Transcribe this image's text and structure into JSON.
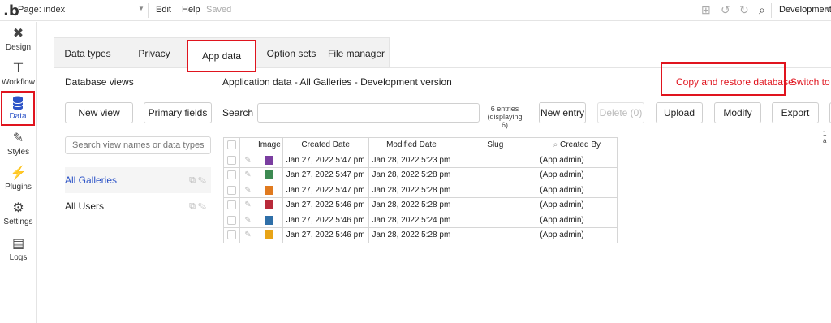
{
  "topbar": {
    "logo": ".b",
    "page_label": "Page: index",
    "menu_edit": "Edit",
    "menu_help": "Help",
    "saved": "Saved",
    "environment": "Development"
  },
  "rail": {
    "items": [
      {
        "label": "Design",
        "icon": "design-icon"
      },
      {
        "label": "Workflow",
        "icon": "workflow-icon"
      },
      {
        "label": "Data",
        "icon": "database-icon"
      },
      {
        "label": "Styles",
        "icon": "brush-icon"
      },
      {
        "label": "Plugins",
        "icon": "plug-icon"
      },
      {
        "label": "Settings",
        "icon": "gear-icon"
      },
      {
        "label": "Logs",
        "icon": "document-icon"
      }
    ],
    "active": "Data"
  },
  "tabs": [
    {
      "label": "Data types"
    },
    {
      "label": "Privacy"
    },
    {
      "label": "App data"
    },
    {
      "label": "Option sets"
    },
    {
      "label": "File manager"
    }
  ],
  "active_tab": "App data",
  "left": {
    "title": "Database views",
    "new_view": "New view",
    "primary_fields": "Primary fields",
    "search_placeholder": "Search view names or data types...",
    "views": [
      {
        "label": "All Galleries"
      },
      {
        "label": "All Users"
      }
    ]
  },
  "main": {
    "title": "Application data - All Galleries - Development version",
    "copy_restore": "Copy and restore database",
    "switch_live": "Switch to li",
    "search_label": "Search",
    "entries_line1": "6 entries",
    "entries_line2": "(displaying 6)",
    "new_entry": "New entry",
    "delete": "Delete (0)",
    "upload": "Upload",
    "modify": "Modify",
    "export": "Export",
    "tiny": "1 a"
  },
  "table": {
    "columns": [
      "Image",
      "Created Date",
      "Modified Date",
      "Slug",
      "Created By"
    ],
    "rows": [
      {
        "created": "Jan 27, 2022 5:47 pm",
        "modified": "Jan 28, 2022 5:23 pm",
        "slug": "",
        "by": "(App admin)",
        "thumb": "#7a3ea0"
      },
      {
        "created": "Jan 27, 2022 5:47 pm",
        "modified": "Jan 28, 2022 5:28 pm",
        "slug": "",
        "by": "(App admin)",
        "thumb": "#3d8a52"
      },
      {
        "created": "Jan 27, 2022 5:47 pm",
        "modified": "Jan 28, 2022 5:28 pm",
        "slug": "",
        "by": "(App admin)",
        "thumb": "#e07a1f"
      },
      {
        "created": "Jan 27, 2022 5:46 pm",
        "modified": "Jan 28, 2022 5:28 pm",
        "slug": "",
        "by": "(App admin)",
        "thumb": "#b82a3a"
      },
      {
        "created": "Jan 27, 2022 5:46 pm",
        "modified": "Jan 28, 2022 5:24 pm",
        "slug": "",
        "by": "(App admin)",
        "thumb": "#2f6fa8"
      },
      {
        "created": "Jan 27, 2022 5:46 pm",
        "modified": "Jan 28, 2022 5:28 pm",
        "slug": "",
        "by": "(App admin)",
        "thumb": "#e8a417"
      }
    ]
  },
  "colors": {
    "accent": "#2c53c7",
    "highlight": "#e0141e"
  }
}
